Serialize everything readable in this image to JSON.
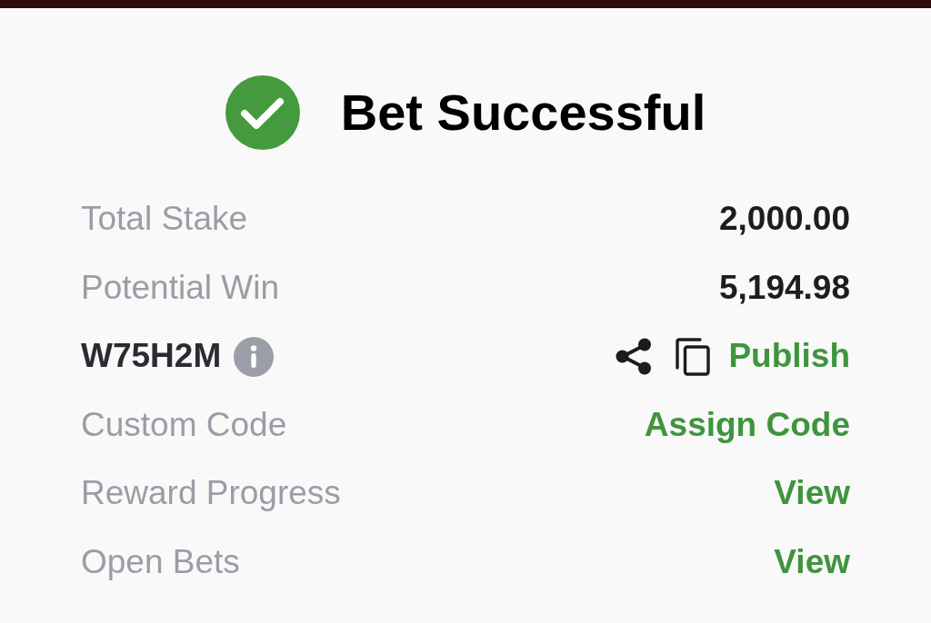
{
  "header": {
    "title": "Bet Successful"
  },
  "rows": [
    {
      "kind": "value",
      "label": "Total Stake",
      "value": "2,000.00"
    },
    {
      "kind": "value",
      "label": "Potential Win",
      "value": "5,194.98"
    },
    {
      "kind": "code",
      "code": "W75H2M",
      "action": "Publish"
    },
    {
      "kind": "link",
      "label": "Custom Code",
      "action": "Assign Code"
    },
    {
      "kind": "link",
      "label": "Reward Progress",
      "action": "View"
    },
    {
      "kind": "link",
      "label": "Open Bets",
      "action": "View"
    }
  ]
}
